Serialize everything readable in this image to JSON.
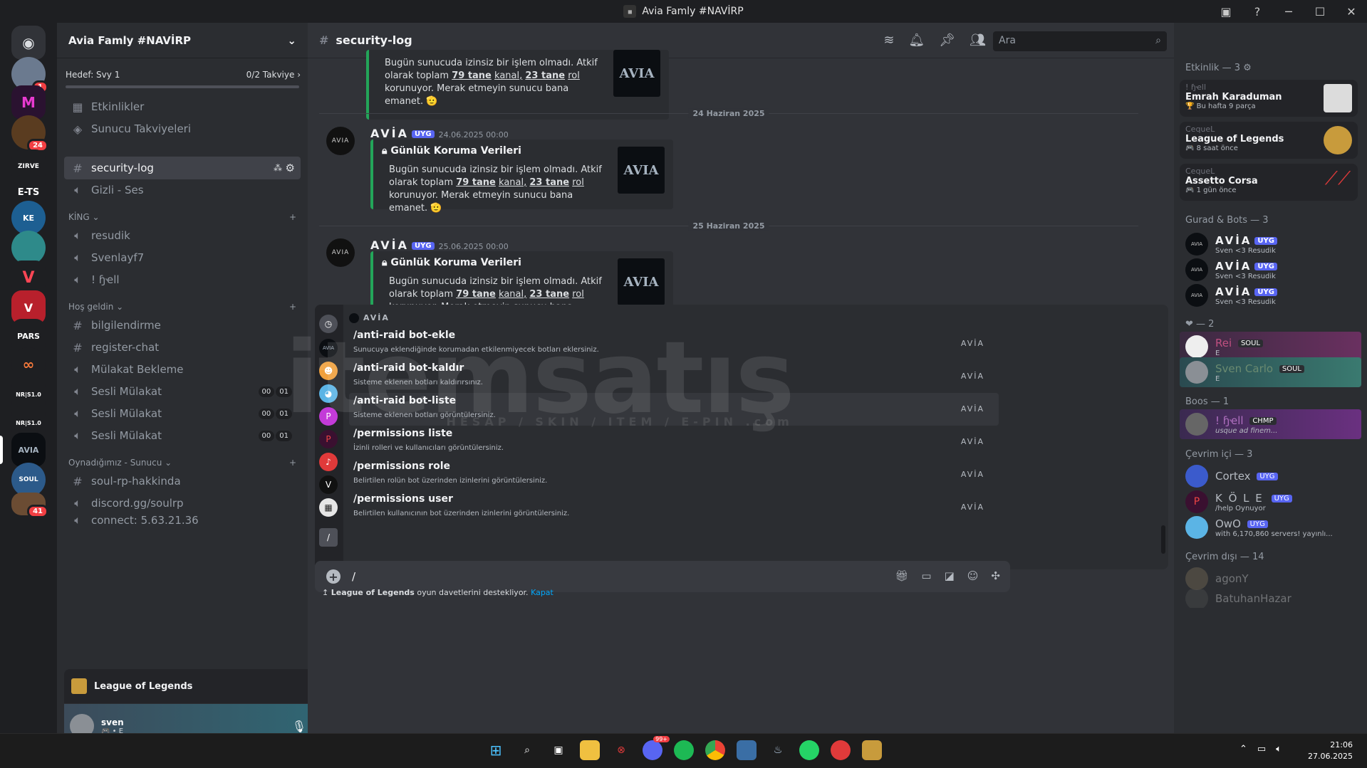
{
  "window": {
    "title": "Avia Famly #NAVİRP"
  },
  "rail": {
    "servers": [
      "",
      "",
      "",
      "ZIRVE",
      "E-TS",
      "KE",
      "",
      "",
      "",
      "PARS",
      "",
      "NR|S1.0",
      "NR|S1.0",
      "AVIA",
      "SOUL",
      ""
    ],
    "badges": [
      "1",
      "24",
      "41"
    ]
  },
  "guild": {
    "name": "Avia Famly #NAVİRP",
    "boost_goal": "Hedef: Svy 1",
    "boost_count": "0/2 Takviye"
  },
  "channels": {
    "events": "Etkinlikler",
    "boosts": "Sunucu Takviyeleri",
    "security": "security-log",
    "gizli": "Gizli - Ses",
    "cat_king": "KİNG",
    "resudik": "resudik",
    "svenlayf": "Svenlayf7",
    "hell": "! ɧҽll",
    "cat_hos": "Hoş geldin",
    "bilgi": "bilgilendirme",
    "register": "register-chat",
    "mulakat": "Mülakat Bekleme",
    "sesli1": "Sesli Mülakat",
    "sesli2": "Sesli Mülakat",
    "sesli3": "Sesli Mülakat",
    "v0": "00",
    "v1": "01",
    "cat_oyna": "Oynadığımız - Sunucu",
    "soul": "soul-rp-hakkinda",
    "discord": "discord.gg/soulrp",
    "connect": "connect: 5.63.21.36"
  },
  "game_panel": {
    "game": "League of Legends"
  },
  "user": {
    "name": "sven",
    "status": "E"
  },
  "header": {
    "channel": "security-log",
    "search_placeholder": "Ara"
  },
  "messages": {
    "bot": "AVİA",
    "tag": "UYG",
    "title": "Günlük Koruma Verileri",
    "desc_a": "Bugün sunucuda izinsiz bir işlem olmadı. Atkif olarak toplam",
    "desc_b1": "79 tane",
    "desc_b2": "kanal,",
    "desc_b3": "23 tane",
    "desc_b4": "rol",
    "desc_b5": "korunuyor. Merak etmeyin sunucu",
    "desc_c": "bana emanet. 🫡",
    "thumb": "AVIA",
    "date1": "24 Haziran 2025",
    "time1": "24.06.2025 00:00",
    "date2": "25 Haziran 2025",
    "time2": "25.06.2025 00:00"
  },
  "popup": {
    "bot": "AVİA",
    "commands": [
      {
        "name": "/anti-raid bot-ekle",
        "desc": "Sunucuya eklendiğinde korumadan etkilenmiyecek botları eklersiniz.",
        "bot": "AVİA"
      },
      {
        "name": "/anti-raid bot-kaldır",
        "desc": "Sisteme eklenen botları kaldırırsınız.",
        "bot": "AVİA"
      },
      {
        "name": "/anti-raid bot-liste",
        "desc": "Sisteme eklenen botları görüntülersiniz.",
        "bot": "AVİA"
      },
      {
        "name": "/permissions liste",
        "desc": "İzinli rolleri ve kullanıcıları görüntülersiniz.",
        "bot": "AVİA"
      },
      {
        "name": "/permissions role",
        "desc": "Belirtilen rolün bot üzerinden izinlerini görüntülersiniz.",
        "bot": "AVİA"
      },
      {
        "name": "/permissions user",
        "desc": "Belirtilen kullanıcının bot üzerinden izinlerini görüntülersiniz.",
        "bot": "AVİA"
      }
    ]
  },
  "composer": {
    "value": "/",
    "hint_game": "League of Legends",
    "hint_text": "oyun davetlerini destekliyor.",
    "hint_link": "Kapat"
  },
  "members": {
    "activity_hdr": "Etkinlik — 3",
    "activities": [
      {
        "user": "! ɧҽll",
        "game": "Emrah Karaduman",
        "sub": "Bu hafta 9 parça"
      },
      {
        "user": "CequeL",
        "game": "League of Legends",
        "sub": "8 saat önce"
      },
      {
        "user": "CequeL",
        "game": "Assetto Corsa",
        "sub": "1 gün önce"
      }
    ],
    "bots_hdr": "Gurad & Bots — 3",
    "bots": [
      {
        "name": "AVİA",
        "tag": "UYG",
        "status": "Sven <3 Resudik"
      },
      {
        "name": "AVİA",
        "tag": "UYG",
        "status": "Sven <3 Resudik"
      },
      {
        "name": "AVİA",
        "tag": "UYG",
        "status": "Sven <3 Resudik"
      }
    ],
    "heart_hdr": "— 2",
    "hearts": [
      {
        "name": "Rei",
        "badge": "SOUL",
        "status": "E"
      },
      {
        "name": "Sven Carlo",
        "badge": "SOUL",
        "status": "E"
      }
    ],
    "boos_hdr": "Boos — 1",
    "boos": [
      {
        "name": "! ɧҽll",
        "badge": "CHMP",
        "status": "usque ad finem..."
      }
    ],
    "online_hdr": "Çevrim içi — 3",
    "online": [
      {
        "name": "Cortex",
        "tag": "UYG",
        "status": ""
      },
      {
        "name": "K Ö L E",
        "tag": "UYG",
        "status": "/help Oynuyor"
      },
      {
        "name": "OwO",
        "tag": "UYG",
        "status": "with 6,170,860 servers! yayınlı..."
      }
    ],
    "offline_hdr": "Çevrim dışı — 14",
    "offline": [
      {
        "name": "agonY"
      },
      {
        "name": "BatuhanHazar"
      }
    ]
  },
  "taskbar": {
    "time": "21:06",
    "date": "27.06.2025",
    "discord_badge": "99+"
  },
  "watermark": {
    "text": "itemsatış",
    "sub": "HESAP / SKIN / ITEM / E-PIN .com"
  }
}
